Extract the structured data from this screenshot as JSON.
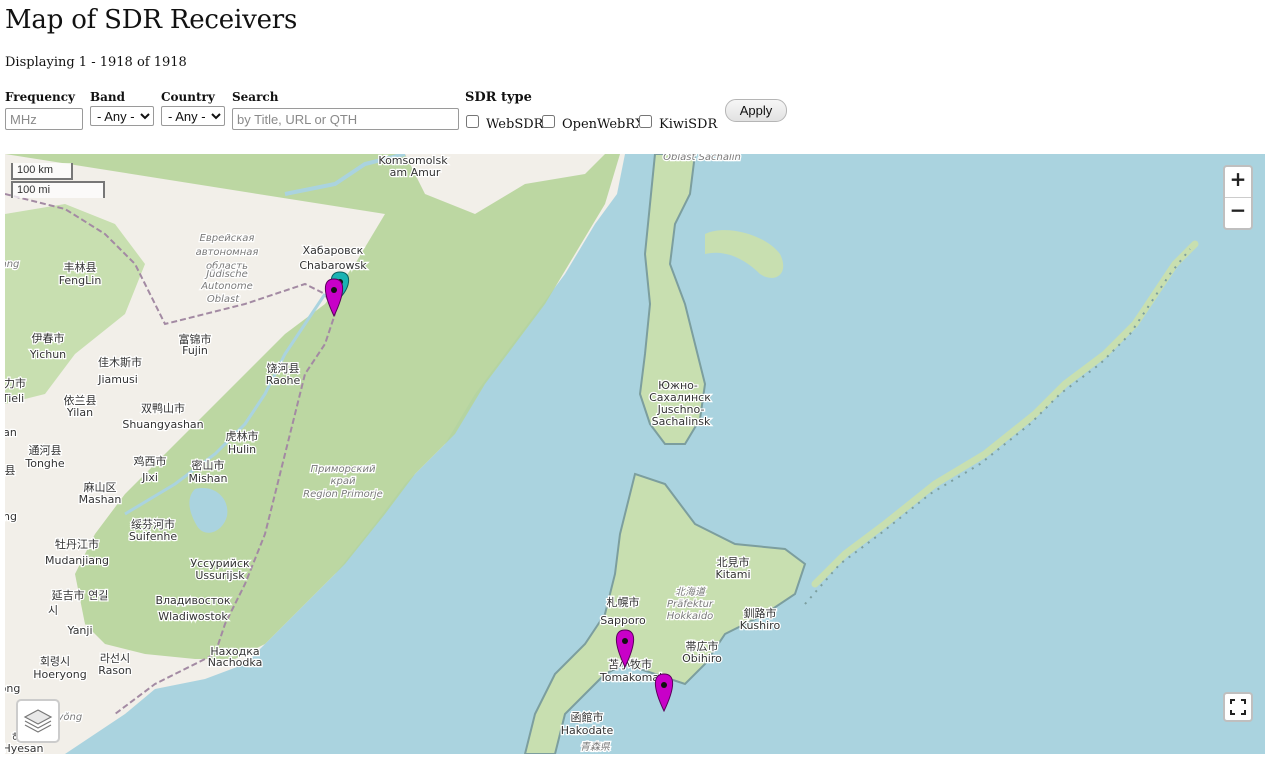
{
  "page": {
    "title": "Map of SDR Receivers",
    "count_text": "Displaying 1 - 1918 of 1918"
  },
  "filters": {
    "frequency_label": "Frequency",
    "frequency_placeholder": "MHz",
    "band_label": "Band",
    "band_value": "- Any -",
    "country_label": "Country",
    "country_value": "- Any -",
    "search_label": "Search",
    "search_placeholder": "by Title, URL or QTH",
    "sdr_type_label": "SDR type",
    "types": [
      {
        "label": "WebSDR",
        "checked": false
      },
      {
        "label": "OpenWebRX",
        "checked": false
      },
      {
        "label": "KiwiSDR",
        "checked": false
      }
    ],
    "apply_label": "Apply"
  },
  "map": {
    "zoom_in": "+",
    "zoom_out": "−",
    "scale_km": "100 km",
    "scale_mi": "100 mi",
    "colors": {
      "water": "#aad3df",
      "land": "#f2efe9",
      "forest": "#b6d49a",
      "websdr_marker": "#c800c8",
      "openwebrx_marker": "#1ab3b3"
    },
    "place_labels": [
      {
        "name": "Komsomolsk",
        "cls": "city"
      },
      {
        "name": "am Amur",
        "cls": "city"
      },
      {
        "name": "Oblast Sachalin",
        "cls": "region"
      },
      {
        "name": "Хабаровск",
        "cls": "city"
      },
      {
        "name": "Chabarowsk",
        "cls": "city"
      },
      {
        "name": "Еврейская",
        "cls": "region"
      },
      {
        "name": "автономная",
        "cls": "region"
      },
      {
        "name": "область",
        "cls": "region"
      },
      {
        "name": "Jüdische",
        "cls": "region"
      },
      {
        "name": "Autonome",
        "cls": "region"
      },
      {
        "name": "Oblast",
        "cls": "region"
      },
      {
        "name": "丰林县",
        "cls": "city"
      },
      {
        "name": "FengLin",
        "cls": "city"
      },
      {
        "name": "伊春市",
        "cls": "city"
      },
      {
        "name": "Yichun",
        "cls": "city"
      },
      {
        "name": "富锦市",
        "cls": "city"
      },
      {
        "name": "Fujin",
        "cls": "city"
      },
      {
        "name": "佳木斯市",
        "cls": "city"
      },
      {
        "name": "Jiamusi",
        "cls": "city"
      },
      {
        "name": "饶河县",
        "cls": "city"
      },
      {
        "name": "Raohe",
        "cls": "city"
      },
      {
        "name": "Южно-",
        "cls": "city"
      },
      {
        "name": "Сахалинск",
        "cls": "city"
      },
      {
        "name": "Juschno-",
        "cls": "city"
      },
      {
        "name": "Sachalinsk",
        "cls": "city"
      },
      {
        "name": "依兰县",
        "cls": "city"
      },
      {
        "name": "Yilan",
        "cls": "city"
      },
      {
        "name": "双鸭山市",
        "cls": "city"
      },
      {
        "name": "Shuangyashan",
        "cls": "city"
      },
      {
        "name": "虎林市",
        "cls": "city"
      },
      {
        "name": "Hulin",
        "cls": "city"
      },
      {
        "name": "通河县",
        "cls": "city"
      },
      {
        "name": "Tonghe",
        "cls": "city"
      },
      {
        "name": "鸡西市",
        "cls": "city"
      },
      {
        "name": "Jixi",
        "cls": "city"
      },
      {
        "name": "密山市",
        "cls": "city"
      },
      {
        "name": "Mishan",
        "cls": "city"
      },
      {
        "name": "Приморский",
        "cls": "region"
      },
      {
        "name": "край",
        "cls": "region"
      },
      {
        "name": "Region Primorje",
        "cls": "region"
      },
      {
        "name": "麻山区",
        "cls": "city"
      },
      {
        "name": "Mashan",
        "cls": "city"
      },
      {
        "name": "绥芬河市",
        "cls": "city"
      },
      {
        "name": "Suifenhe",
        "cls": "city"
      },
      {
        "name": "牡丹江市",
        "cls": "city"
      },
      {
        "name": "Mudanjiang",
        "cls": "city"
      },
      {
        "name": "Уссурийск",
        "cls": "city"
      },
      {
        "name": "Ussurijsk",
        "cls": "city"
      },
      {
        "name": "北見市",
        "cls": "city"
      },
      {
        "name": "Kitami",
        "cls": "city"
      },
      {
        "name": "札幌市",
        "cls": "city"
      },
      {
        "name": "Sapporo",
        "cls": "city"
      },
      {
        "name": "北海道",
        "cls": "region"
      },
      {
        "name": "Präfektur",
        "cls": "region"
      },
      {
        "name": "Hokkaido",
        "cls": "region"
      },
      {
        "name": "延吉市 연길",
        "cls": "city"
      },
      {
        "name": "시",
        "cls": "city"
      },
      {
        "name": "Yanji",
        "cls": "city"
      },
      {
        "name": "Владивосток",
        "cls": "city"
      },
      {
        "name": "Wladiwostok",
        "cls": "city"
      },
      {
        "name": "釧路市",
        "cls": "city"
      },
      {
        "name": "Kushiro",
        "cls": "city"
      },
      {
        "name": "帯広市",
        "cls": "city"
      },
      {
        "name": "Obihiro",
        "cls": "city"
      },
      {
        "name": "회령시",
        "cls": "city"
      },
      {
        "name": "Hoeryong",
        "cls": "city"
      },
      {
        "name": "라선시",
        "cls": "city"
      },
      {
        "name": "Rason",
        "cls": "city"
      },
      {
        "name": "Находка",
        "cls": "city"
      },
      {
        "name": "Nachodka",
        "cls": "city"
      },
      {
        "name": "苫小牧市",
        "cls": "city"
      },
      {
        "name": "Tomakomai",
        "cls": "city"
      },
      {
        "name": "函館市",
        "cls": "city"
      },
      {
        "name": "Hakodate",
        "cls": "city"
      },
      {
        "name": "d-Hamgyŏng",
        "cls": "region"
      },
      {
        "name": "青森県",
        "cls": "region"
      },
      {
        "name": "ang",
        "cls": "region"
      },
      {
        "name": "力市",
        "cls": "city"
      },
      {
        "name": "Tieli",
        "cls": "city"
      },
      {
        "name": "an",
        "cls": "city"
      },
      {
        "name": "县",
        "cls": "city"
      },
      {
        "name": "ng",
        "cls": "city"
      },
      {
        "name": "ong",
        "cls": "city"
      },
      {
        "name": "해",
        "cls": "city"
      },
      {
        "name": "Hyesan",
        "cls": "city"
      }
    ]
  }
}
